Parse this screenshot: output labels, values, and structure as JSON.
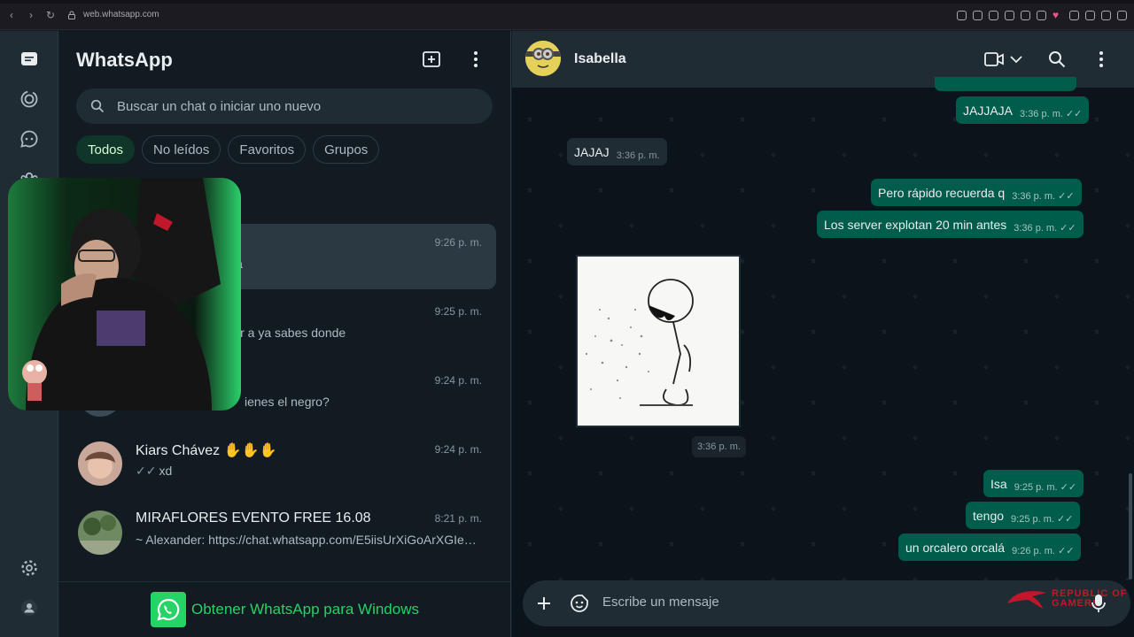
{
  "browser": {
    "url": "web.whatsapp.com"
  },
  "app": {
    "title": "WhatsApp"
  },
  "search": {
    "placeholder": "Buscar un chat o iniciar uno nuevo"
  },
  "filters": [
    {
      "label": "Todos",
      "active": true
    },
    {
      "label": "No leídos",
      "active": false
    },
    {
      "label": "Favoritos",
      "active": false
    },
    {
      "label": "Grupos",
      "active": false
    }
  ],
  "chats": [
    {
      "name": "",
      "time": "9:26 p. m.",
      "preview": "lá",
      "selected": true
    },
    {
      "name": "",
      "time": "9:25 p. m.",
      "preview": "ir a ya sabes donde",
      "selected": false
    },
    {
      "name": "",
      "time": "9:24 p. m.",
      "preview": "ienes el negro?",
      "selected": false
    },
    {
      "name": "Kiars Chávez",
      "time": "9:24 p. m.",
      "preview": "xd",
      "ticks": "✓✓",
      "selected": false
    },
    {
      "name": "MIRAFLORES EVENTO FREE 16.08",
      "time": "8:21 p. m.",
      "preview": "~ Alexander: https://chat.whatsapp.com/E5iisUrXiGoArXGIeK...",
      "selected": false
    }
  ],
  "get_app": {
    "label": "Obtener WhatsApp para Windows"
  },
  "conversation": {
    "contact_name": "Isabella",
    "messages": [
      {
        "dir": "out",
        "text": "JAJJAJA",
        "time": "3:36 p. m.",
        "ticks": "✓✓"
      },
      {
        "dir": "in",
        "text": "JAJAJ",
        "time": "3:36 p. m."
      },
      {
        "dir": "out",
        "text": "Pero rápido recuerda q",
        "time": "3:36 p. m.",
        "ticks": "✓✓"
      },
      {
        "dir": "out",
        "text": "Los server explotan 20 min antes",
        "time": "3:36 p. m.",
        "ticks": "✓✓"
      },
      {
        "dir": "in",
        "type": "image",
        "time": "3:36 p. m."
      },
      {
        "dir": "out",
        "text": "Isa",
        "time": "9:25 p. m.",
        "ticks": "✓✓"
      },
      {
        "dir": "out",
        "text": "tengo",
        "time": "9:25 p. m.",
        "ticks": "✓✓"
      },
      {
        "dir": "out",
        "text": "un orcalero orcalá",
        "time": "9:26 p. m.",
        "ticks": "✓✓"
      }
    ]
  },
  "composer": {
    "placeholder": "Escribe un mensaje"
  },
  "watermark": {
    "line1": "REPUBLIC OF",
    "line2": "GAMERS"
  },
  "colors": {
    "accent": "#25d366",
    "outgoing_bubble": "#005c4b",
    "panel": "#202c33",
    "background": "#111b21"
  }
}
